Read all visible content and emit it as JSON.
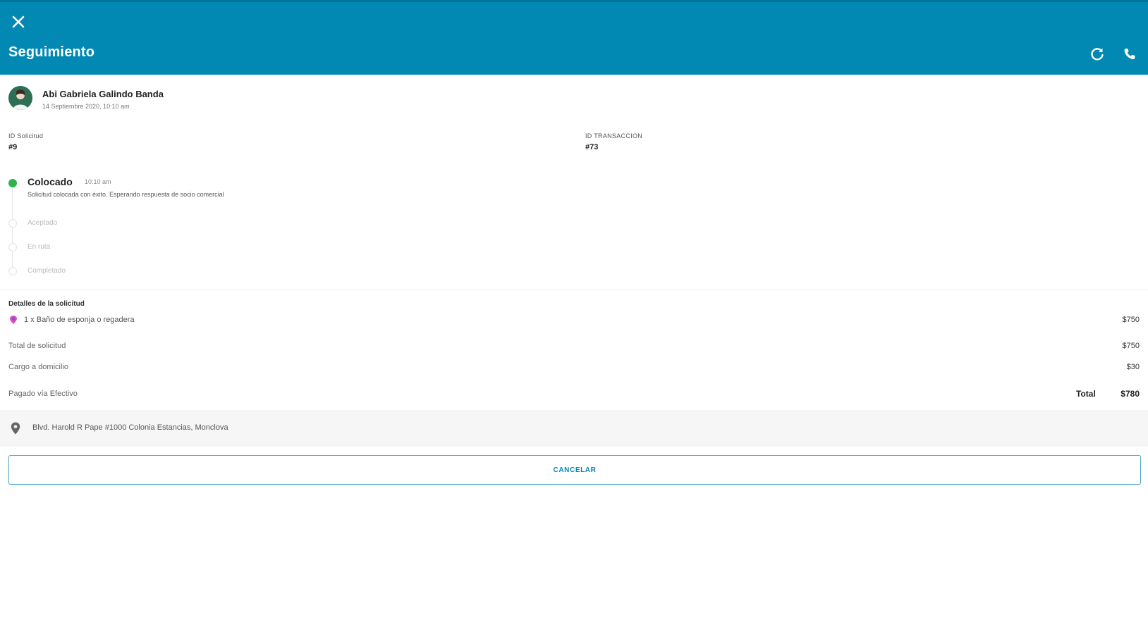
{
  "header": {
    "title": "Seguimiento",
    "close_icon": "close-icon",
    "refresh_icon": "refresh-icon",
    "phone_icon": "phone-icon",
    "background_color": "#0189b4"
  },
  "user": {
    "name": "Abi Gabriela Galindo Banda",
    "date": "14 Septiembre 2020, 10:10 am",
    "avatar_icon": "avatar"
  },
  "order": {
    "request_id_label": "ID Solicitud",
    "request_id_value": "#9",
    "transaction_label": "ID TRANSACCION",
    "transaction_value": "#73"
  },
  "timeline": {
    "current": {
      "title": "Colocado",
      "time": "10:10 am",
      "description": "Solicitud colocada con éxito. Esperando respuesta de socio comercial"
    },
    "pending_steps": [
      "Aceptado",
      "En ruta",
      "Completado"
    ],
    "done_color": "#2fb24c"
  },
  "details": {
    "section_title": "Detalles de la solicitud",
    "items": [
      {
        "description": "1 x Baño de esponja o regadera",
        "amount": "$750",
        "icon": "service-icon"
      }
    ],
    "subtotal_label": "Total de solicitud",
    "subtotal_value": "$750",
    "delivery_label": "Cargo a domicilio",
    "delivery_value": "$30",
    "payment_label": "Pagado vía Efectivo",
    "total_label": "Total",
    "total_value": "$780"
  },
  "address": {
    "text": "Blvd. Harold R Pape #1000 Colonia Estancias, Monclova",
    "icon": "location-pin-icon"
  },
  "cancel_button": {
    "label": "CANCELAR"
  }
}
